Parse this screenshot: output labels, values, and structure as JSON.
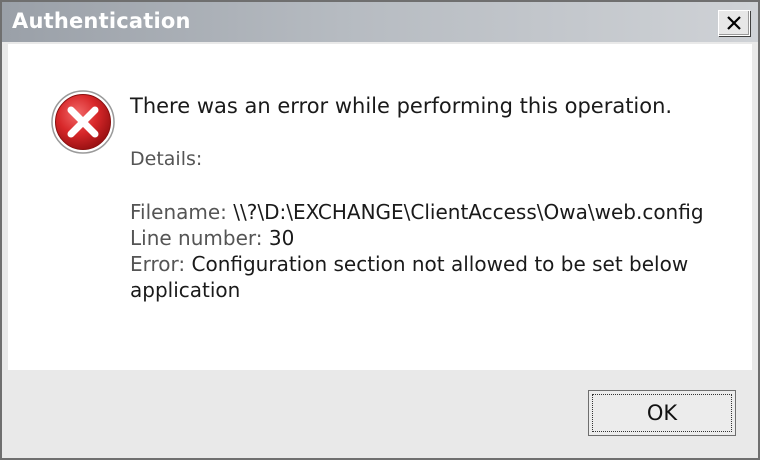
{
  "window": {
    "title": "Authentication"
  },
  "message": {
    "main": "There was an error while performing this operation.",
    "details_label": "Details:",
    "lines": [
      {
        "label": "Filename:",
        "value": "\\\\?\\D:\\EXCHANGE\\ClientAccess\\Owa\\web.config"
      },
      {
        "label": "Line number:",
        "value": "30"
      },
      {
        "label": "Error:",
        "value": "Configuration section not allowed to be set below application"
      }
    ]
  },
  "buttons": {
    "ok_label": "OK"
  },
  "icons": {
    "error": "error-icon",
    "close": "close-icon"
  },
  "colors": {
    "error_red": "#d8282a",
    "titlebar_start": "#9aa0a8",
    "titlebar_end": "#cfd2d6"
  }
}
